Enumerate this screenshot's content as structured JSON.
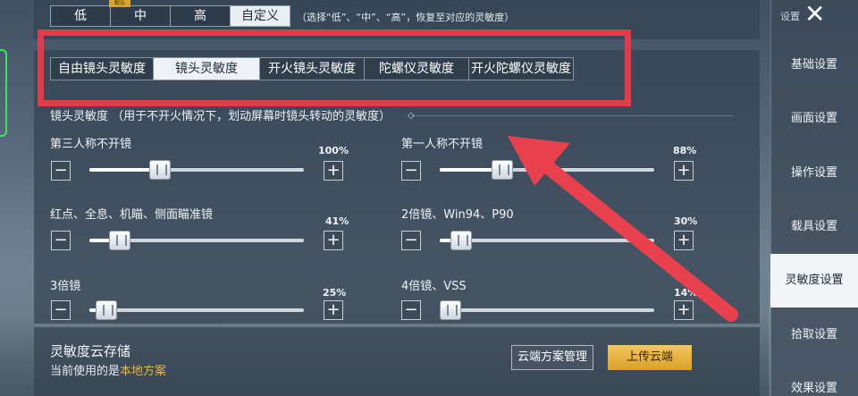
{
  "presets": {
    "items": [
      {
        "label": "低",
        "active": false
      },
      {
        "label": "中",
        "active": false
      },
      {
        "label": "高",
        "active": false
      },
      {
        "label": "自定义",
        "active": true
      }
    ],
    "default_badge": "默认",
    "hint": "（选择“低”、“中”、“高”，恢复至对应的灵敏度）"
  },
  "tabs": [
    {
      "label": "自由镜头灵敏度",
      "active": false
    },
    {
      "label": "镜头灵敏度",
      "active": true
    },
    {
      "label": "开火镜头灵敏度",
      "active": false
    },
    {
      "label": "陀螺仪灵敏度",
      "active": false
    },
    {
      "label": "开火陀螺仪灵敏度",
      "active": false
    }
  ],
  "section": {
    "title": "镜头灵敏度  （用于不开火情况下，划动屏幕时镜头转动的灵敏度）",
    "marker": "◇"
  },
  "sliders": [
    {
      "label": "第三人称不开镜",
      "value": "100%",
      "level": 0.33
    },
    {
      "label": "第一人称不开镜",
      "value": "88%",
      "level": 0.29
    },
    {
      "label": "红点、全息、机瞄、侧面瞄准镜",
      "value": "41%",
      "level": 0.14
    },
    {
      "label": "2倍镜、Win94、P90",
      "value": "30%",
      "level": 0.1
    },
    {
      "label": "3倍镜",
      "value": "25%",
      "level": 0.08
    },
    {
      "label": "4倍镜、VSS",
      "value": "14%",
      "level": 0.05
    }
  ],
  "controls": {
    "minus": "−",
    "plus": "+"
  },
  "storage": {
    "title": "灵敏度云存储",
    "current_prefix": "当前使用的是",
    "current_plan": "本地方案",
    "cloud_manage_label": "云端方案管理",
    "upload_label": "上传云端"
  },
  "sidebar": {
    "header": "设置",
    "close_glyph": "✕",
    "items": [
      {
        "label": "基础设置",
        "active": false
      },
      {
        "label": "画面设置",
        "active": false
      },
      {
        "label": "操作设置",
        "active": false
      },
      {
        "label": "载具设置",
        "active": false
      },
      {
        "label": "灵敏度设置",
        "active": true
      },
      {
        "label": "拾取设置",
        "active": false
      },
      {
        "label": "效果设置",
        "active": false
      }
    ]
  },
  "colors": {
    "highlight_box": "#e23a46",
    "arrow": "#e8404c",
    "accent_gold": "#e9b63a",
    "active_bg": "#eef2f6"
  }
}
